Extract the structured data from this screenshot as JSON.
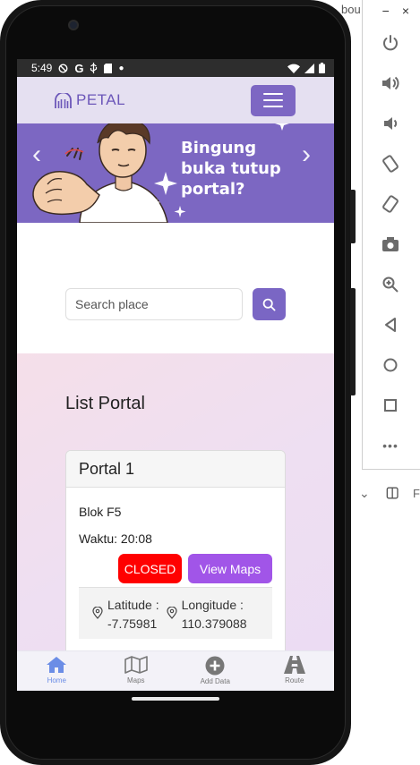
{
  "background": {
    "title_fragment": "bou"
  },
  "emulator": {
    "top_controls": [
      "−",
      "×"
    ],
    "buttons": [
      "power-icon",
      "volume-up-icon",
      "volume-down-icon",
      "rotate-left-icon",
      "rotate-right-icon",
      "camera-icon",
      "zoom-icon",
      "back-icon",
      "home-icon",
      "overview-icon",
      "more-icon"
    ],
    "more_label": "•••"
  },
  "ide_strip": {
    "chevron": "⌄"
  },
  "status_bar": {
    "time": "5:49",
    "icons": [
      "shield-off-icon",
      "google-icon",
      "usb-icon",
      "sd-card-icon",
      "dot-icon",
      "wifi-icon",
      "signal-icon",
      "battery-icon"
    ]
  },
  "app_bar": {
    "brand": "PETAL"
  },
  "banner": {
    "headline": "Bingung buka tutup portal?"
  },
  "search": {
    "placeholder": "Search place"
  },
  "list": {
    "title": "List Portal",
    "cards": [
      {
        "name": "Portal 1",
        "location": "Blok F5",
        "time_label": "Waktu: 20:08",
        "status": "CLOSED",
        "action": "View Maps",
        "lat_label": "Latitude :",
        "lat_value": "-7.75981",
        "lon_label": "Longitude :",
        "lon_value": "110.379088"
      }
    ]
  },
  "bottom_nav": [
    {
      "label": "Home",
      "icon": "home-icon",
      "active": true
    },
    {
      "label": "Maps",
      "icon": "map-icon",
      "active": false
    },
    {
      "label": "Add Data",
      "icon": "plus-circle-icon",
      "active": false
    },
    {
      "label": "Route",
      "icon": "road-icon",
      "active": false
    }
  ],
  "colors": {
    "accent": "#7c67c2",
    "app_bar_bg": "#e5e0f1",
    "closed": "#ff0000",
    "view_maps": "#a155e8",
    "nav_active": "#6b8de6"
  }
}
